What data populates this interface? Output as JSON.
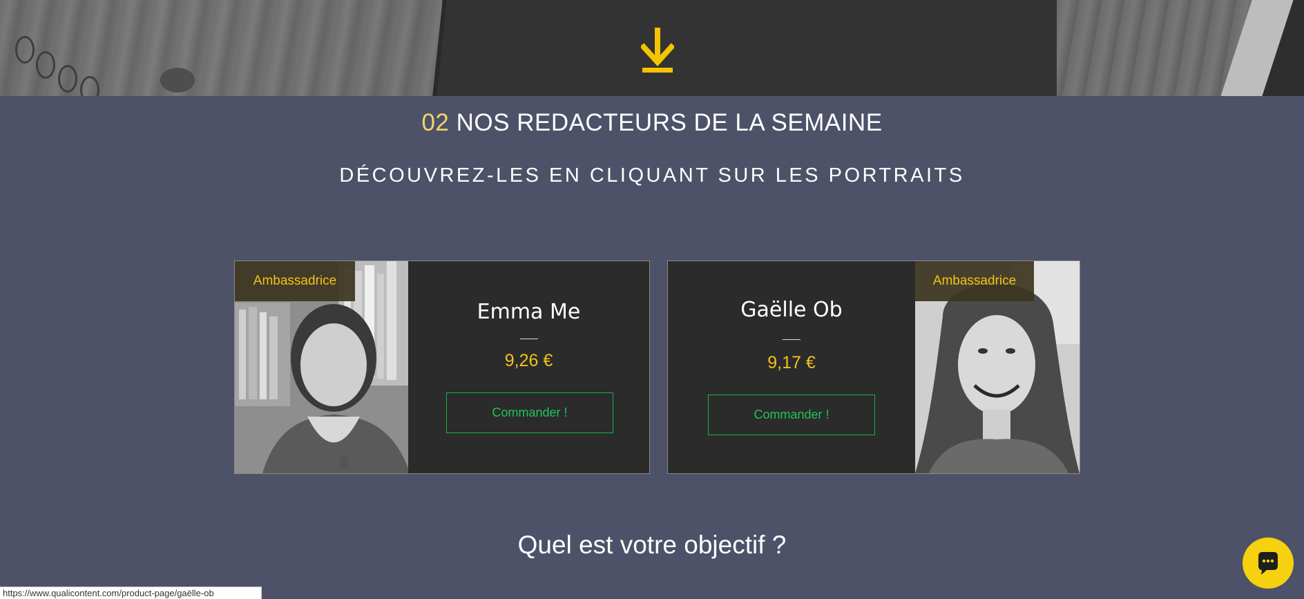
{
  "section": {
    "number": "02",
    "title": "NOS REDACTEURS DE LA SEMAINE",
    "subtitle": "DÉCOUVREZ-LES EN CLIQUANT SUR LES PORTRAITS"
  },
  "writers": [
    {
      "badge": "Ambassadrice",
      "name": "Emma Me",
      "price": "9,26 €",
      "button_label": "Commander !"
    },
    {
      "badge": "Ambassadrice",
      "name": "Gaëlle Ob",
      "price": "9,17 €",
      "button_label": "Commander !"
    }
  ],
  "objective_heading": "Quel est votre objectif ?",
  "status_bar_url": "https://www.qualicontent.com/product-page/gaëlle-ob",
  "icons": {
    "scroll": "download-arrow-icon",
    "chat": "chat-bubble-icon"
  },
  "colors": {
    "background": "#4d5268",
    "accent_yellow": "#f2c318",
    "button_green": "#1fc35a",
    "card_background": "#2b2b2b"
  }
}
